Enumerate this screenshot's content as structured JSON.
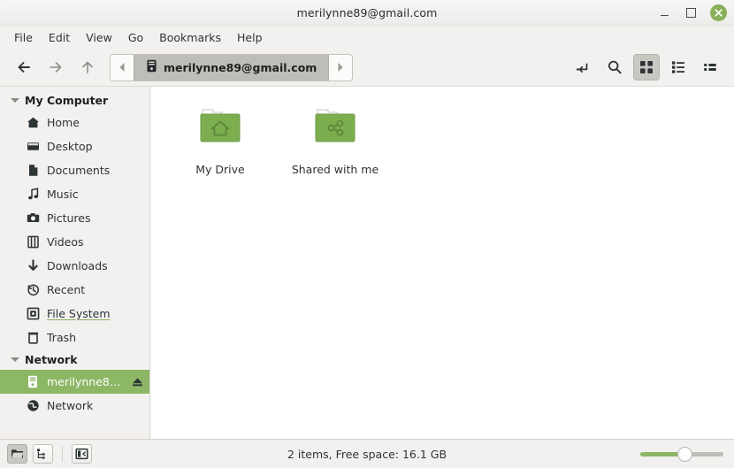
{
  "window": {
    "title": "merilynne89@gmail.com",
    "controls": {
      "minimize": "minimize",
      "maximize": "maximize",
      "close": "close"
    },
    "close_color": "#8ab05a"
  },
  "menubar": {
    "items": [
      {
        "label": "File"
      },
      {
        "label": "Edit"
      },
      {
        "label": "View"
      },
      {
        "label": "Go"
      },
      {
        "label": "Bookmarks"
      },
      {
        "label": "Help"
      }
    ]
  },
  "toolbar": {
    "back": "back-arrow",
    "forward": "forward-arrow",
    "up": "up-arrow",
    "pathbar": {
      "prev_label": "◀",
      "next_label": "▶",
      "crumb_label": "merilynne89@gmail.com",
      "crumb_icon": "server-icon"
    },
    "buttons": [
      {
        "name": "toggle-location-entry",
        "icon": "path-entry-icon",
        "active": false
      },
      {
        "name": "search",
        "icon": "search-icon",
        "active": false
      },
      {
        "name": "icon-view",
        "icon": "grid-view-icon",
        "active": true
      },
      {
        "name": "list-view",
        "icon": "list-view-icon",
        "active": false
      },
      {
        "name": "compact-view",
        "icon": "compact-view-icon",
        "active": false
      }
    ]
  },
  "sidebar": {
    "groups": [
      {
        "label": "My Computer",
        "items": [
          {
            "label": "Home",
            "icon": "home-icon",
            "state": "normal"
          },
          {
            "label": "Desktop",
            "icon": "desktop-icon",
            "state": "normal"
          },
          {
            "label": "Documents",
            "icon": "document-icon",
            "state": "normal"
          },
          {
            "label": "Music",
            "icon": "music-note-icon",
            "state": "normal"
          },
          {
            "label": "Pictures",
            "icon": "camera-icon",
            "state": "normal"
          },
          {
            "label": "Videos",
            "icon": "film-icon",
            "state": "normal"
          },
          {
            "label": "Downloads",
            "icon": "download-arrow-icon",
            "state": "normal"
          },
          {
            "label": "Recent",
            "icon": "clock-history-icon",
            "state": "normal"
          },
          {
            "label": "File System",
            "icon": "disk-icon",
            "state": "hovered"
          },
          {
            "label": "Trash",
            "icon": "trash-icon",
            "state": "normal"
          }
        ]
      },
      {
        "label": "Network",
        "items": [
          {
            "label": "merilynne8…",
            "icon": "server-icon",
            "state": "selected",
            "eject": "eject-icon"
          },
          {
            "label": "Network",
            "icon": "globe-icon",
            "state": "normal"
          }
        ]
      }
    ],
    "selection_color": "#8cb765"
  },
  "main": {
    "files": [
      {
        "label": "My Drive",
        "icon": "folder-home-icon",
        "color": "#7cae50"
      },
      {
        "label": "Shared with me",
        "icon": "folder-share-icon",
        "color": "#7cae50"
      }
    ]
  },
  "statusbar": {
    "buttons": [
      {
        "name": "places-view",
        "icon": "folder-open-icon",
        "pressed": true
      },
      {
        "name": "tree-view",
        "icon": "tree-icon",
        "pressed": false
      },
      {
        "name": "toggle-sidebar",
        "icon": "sidebar-toggle-icon",
        "pressed": false
      }
    ],
    "status_text": "2 items, Free space: 16.1 GB",
    "zoom": {
      "value": 55,
      "fill_color": "#8cb765"
    }
  }
}
